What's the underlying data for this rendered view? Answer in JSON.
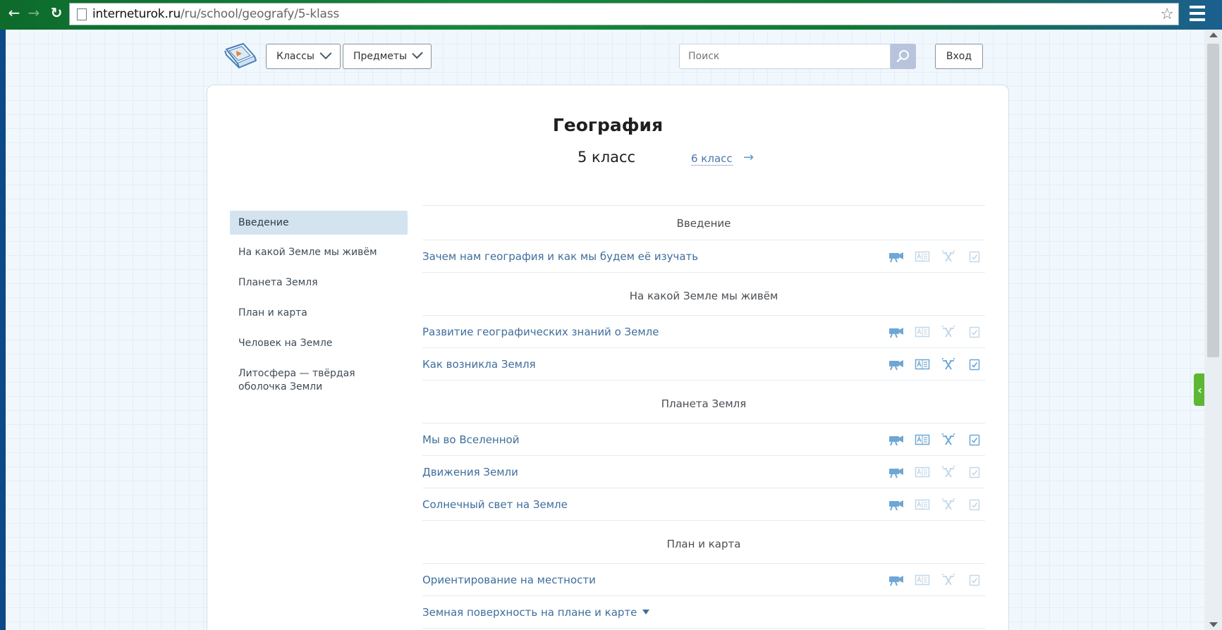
{
  "browser": {
    "url_host": "interneturok.ru",
    "url_path": "/ru/school/geografy/5-klass"
  },
  "header": {
    "classes_label": "Классы",
    "subjects_label": "Предметы",
    "search_placeholder": "Поиск",
    "login_label": "Вход"
  },
  "page": {
    "title": "География",
    "grade": "5 класс",
    "next_grade": "6 класс"
  },
  "sidebar": {
    "items": [
      {
        "label": "Введение",
        "active": true
      },
      {
        "label": "На какой Земле мы живём"
      },
      {
        "label": "Планета Земля"
      },
      {
        "label": "План и карта"
      },
      {
        "label": "Человек на Земле"
      },
      {
        "label": "Литосфера — твёрдая оболочка Земли"
      }
    ]
  },
  "sections": [
    {
      "title": "Введение",
      "lessons": [
        {
          "title": "Зачем нам география и как мы будем её изучать"
        }
      ]
    },
    {
      "title": "На какой Земле мы живём",
      "lessons": [
        {
          "title": "Развитие географических знаний о Земле"
        },
        {
          "title": "Как возникла Земля"
        }
      ]
    },
    {
      "title": "Планета Земля",
      "lessons": [
        {
          "title": "Мы во Вселенной"
        },
        {
          "title": "Движения Земли"
        },
        {
          "title": "Солнечный свет на Земле"
        }
      ]
    },
    {
      "title": "План и карта",
      "lessons": [
        {
          "title": "Ориентирование на местности"
        },
        {
          "title": "Земная поверхность на плане и карте"
        }
      ]
    }
  ],
  "colors": {
    "accent_blue": "#3f6e9d",
    "active_tab": "#d3e3ef",
    "icon_blue": "#6ea7d6",
    "icon_faint": "#c3d7e8",
    "side_tab_green": "#5cb832"
  }
}
